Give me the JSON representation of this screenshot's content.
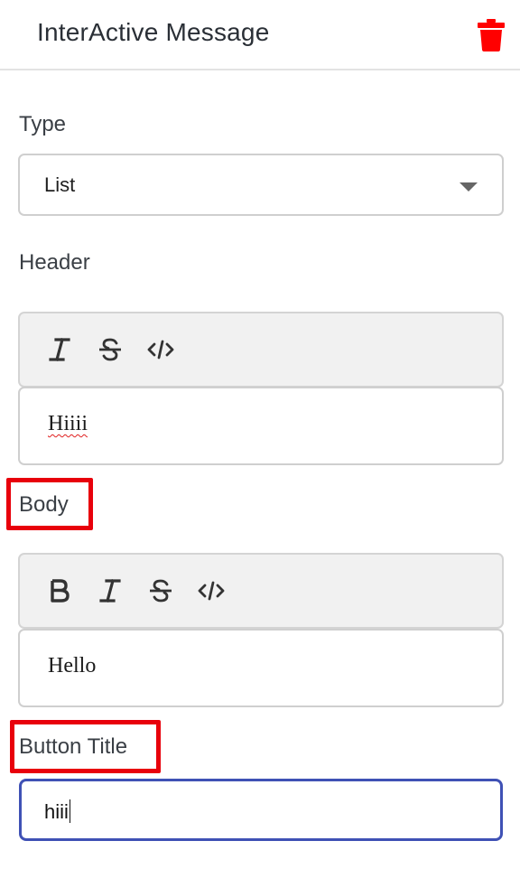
{
  "header": {
    "title": "InterActive Message",
    "delete_icon": "trash-icon",
    "delete_color": "#ff0000"
  },
  "type_field": {
    "label": "Type",
    "value": "List"
  },
  "header_field": {
    "label": "Header",
    "toolbar": [
      "italic-icon",
      "strikethrough-icon",
      "code-icon"
    ],
    "value": "Hiiii"
  },
  "body_field": {
    "label": "Body",
    "toolbar": [
      "bold-icon",
      "italic-icon",
      "strikethrough-icon",
      "code-icon"
    ],
    "value": "Hello"
  },
  "button_title_field": {
    "label": "Button Title",
    "value": "hiii"
  },
  "colors": {
    "highlight": "#e8000b",
    "focus_border": "#3f51b5"
  }
}
